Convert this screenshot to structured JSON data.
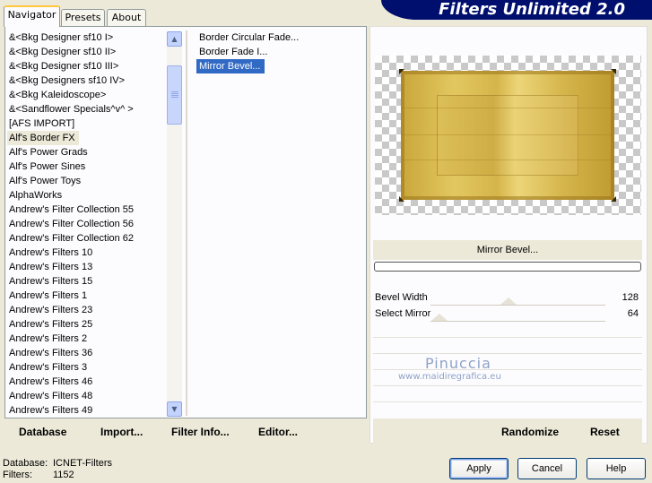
{
  "title": "Filters Unlimited 2.0",
  "tabs": [
    {
      "label": "Navigator"
    },
    {
      "label": "Presets"
    },
    {
      "label": "About"
    }
  ],
  "categories": [
    "&<Bkg Designer sf10 I>",
    "&<Bkg Designer sf10 II>",
    "&<Bkg Designer sf10 III>",
    "&<Bkg Designers sf10 IV>",
    "&<Bkg Kaleidoscope>",
    "&<Sandflower Specials^v^ >",
    "[AFS IMPORT]",
    "Alf's Border FX",
    "Alf's Power Grads",
    "Alf's Power Sines",
    "Alf's Power Toys",
    "AlphaWorks",
    "Andrew's Filter Collection 55",
    "Andrew's Filter Collection 56",
    "Andrew's Filter Collection 62",
    "Andrew's Filters 10",
    "Andrew's Filters 13",
    "Andrew's Filters 15",
    "Andrew's Filters 1",
    "Andrew's Filters 23",
    "Andrew's Filters 25",
    "Andrew's Filters 2",
    "Andrew's Filters 36",
    "Andrew's Filters 3",
    "Andrew's Filters 46",
    "Andrew's Filters 48",
    "Andrew's Filters 49"
  ],
  "filters": [
    "Border Circular Fade...",
    "Border Fade I...",
    "Mirror Bevel..."
  ],
  "left_toolbar": {
    "database": "Database",
    "import": "Import...",
    "filter_info": "Filter Info...",
    "editor": "Editor..."
  },
  "selected_filter_label": "Mirror Bevel...",
  "params": [
    {
      "label": "Bevel Width",
      "value": "128"
    },
    {
      "label": "Select Mirror",
      "value": "64"
    }
  ],
  "watermark": {
    "name": "Pinuccia",
    "url": "www.maidiregrafica.eu"
  },
  "right_toolbar": {
    "randomize": "Randomize",
    "reset": "Reset"
  },
  "footer": {
    "database_label": "Database:",
    "database_value": "ICNET-Filters",
    "filters_label": "Filters:",
    "filters_value": "1152"
  },
  "buttons": {
    "apply": "Apply",
    "cancel": "Cancel",
    "help": "Help"
  },
  "colors": {
    "banner": "#000f6e",
    "selection": "#316ac5",
    "dialog_bg": "#ece9d8"
  }
}
